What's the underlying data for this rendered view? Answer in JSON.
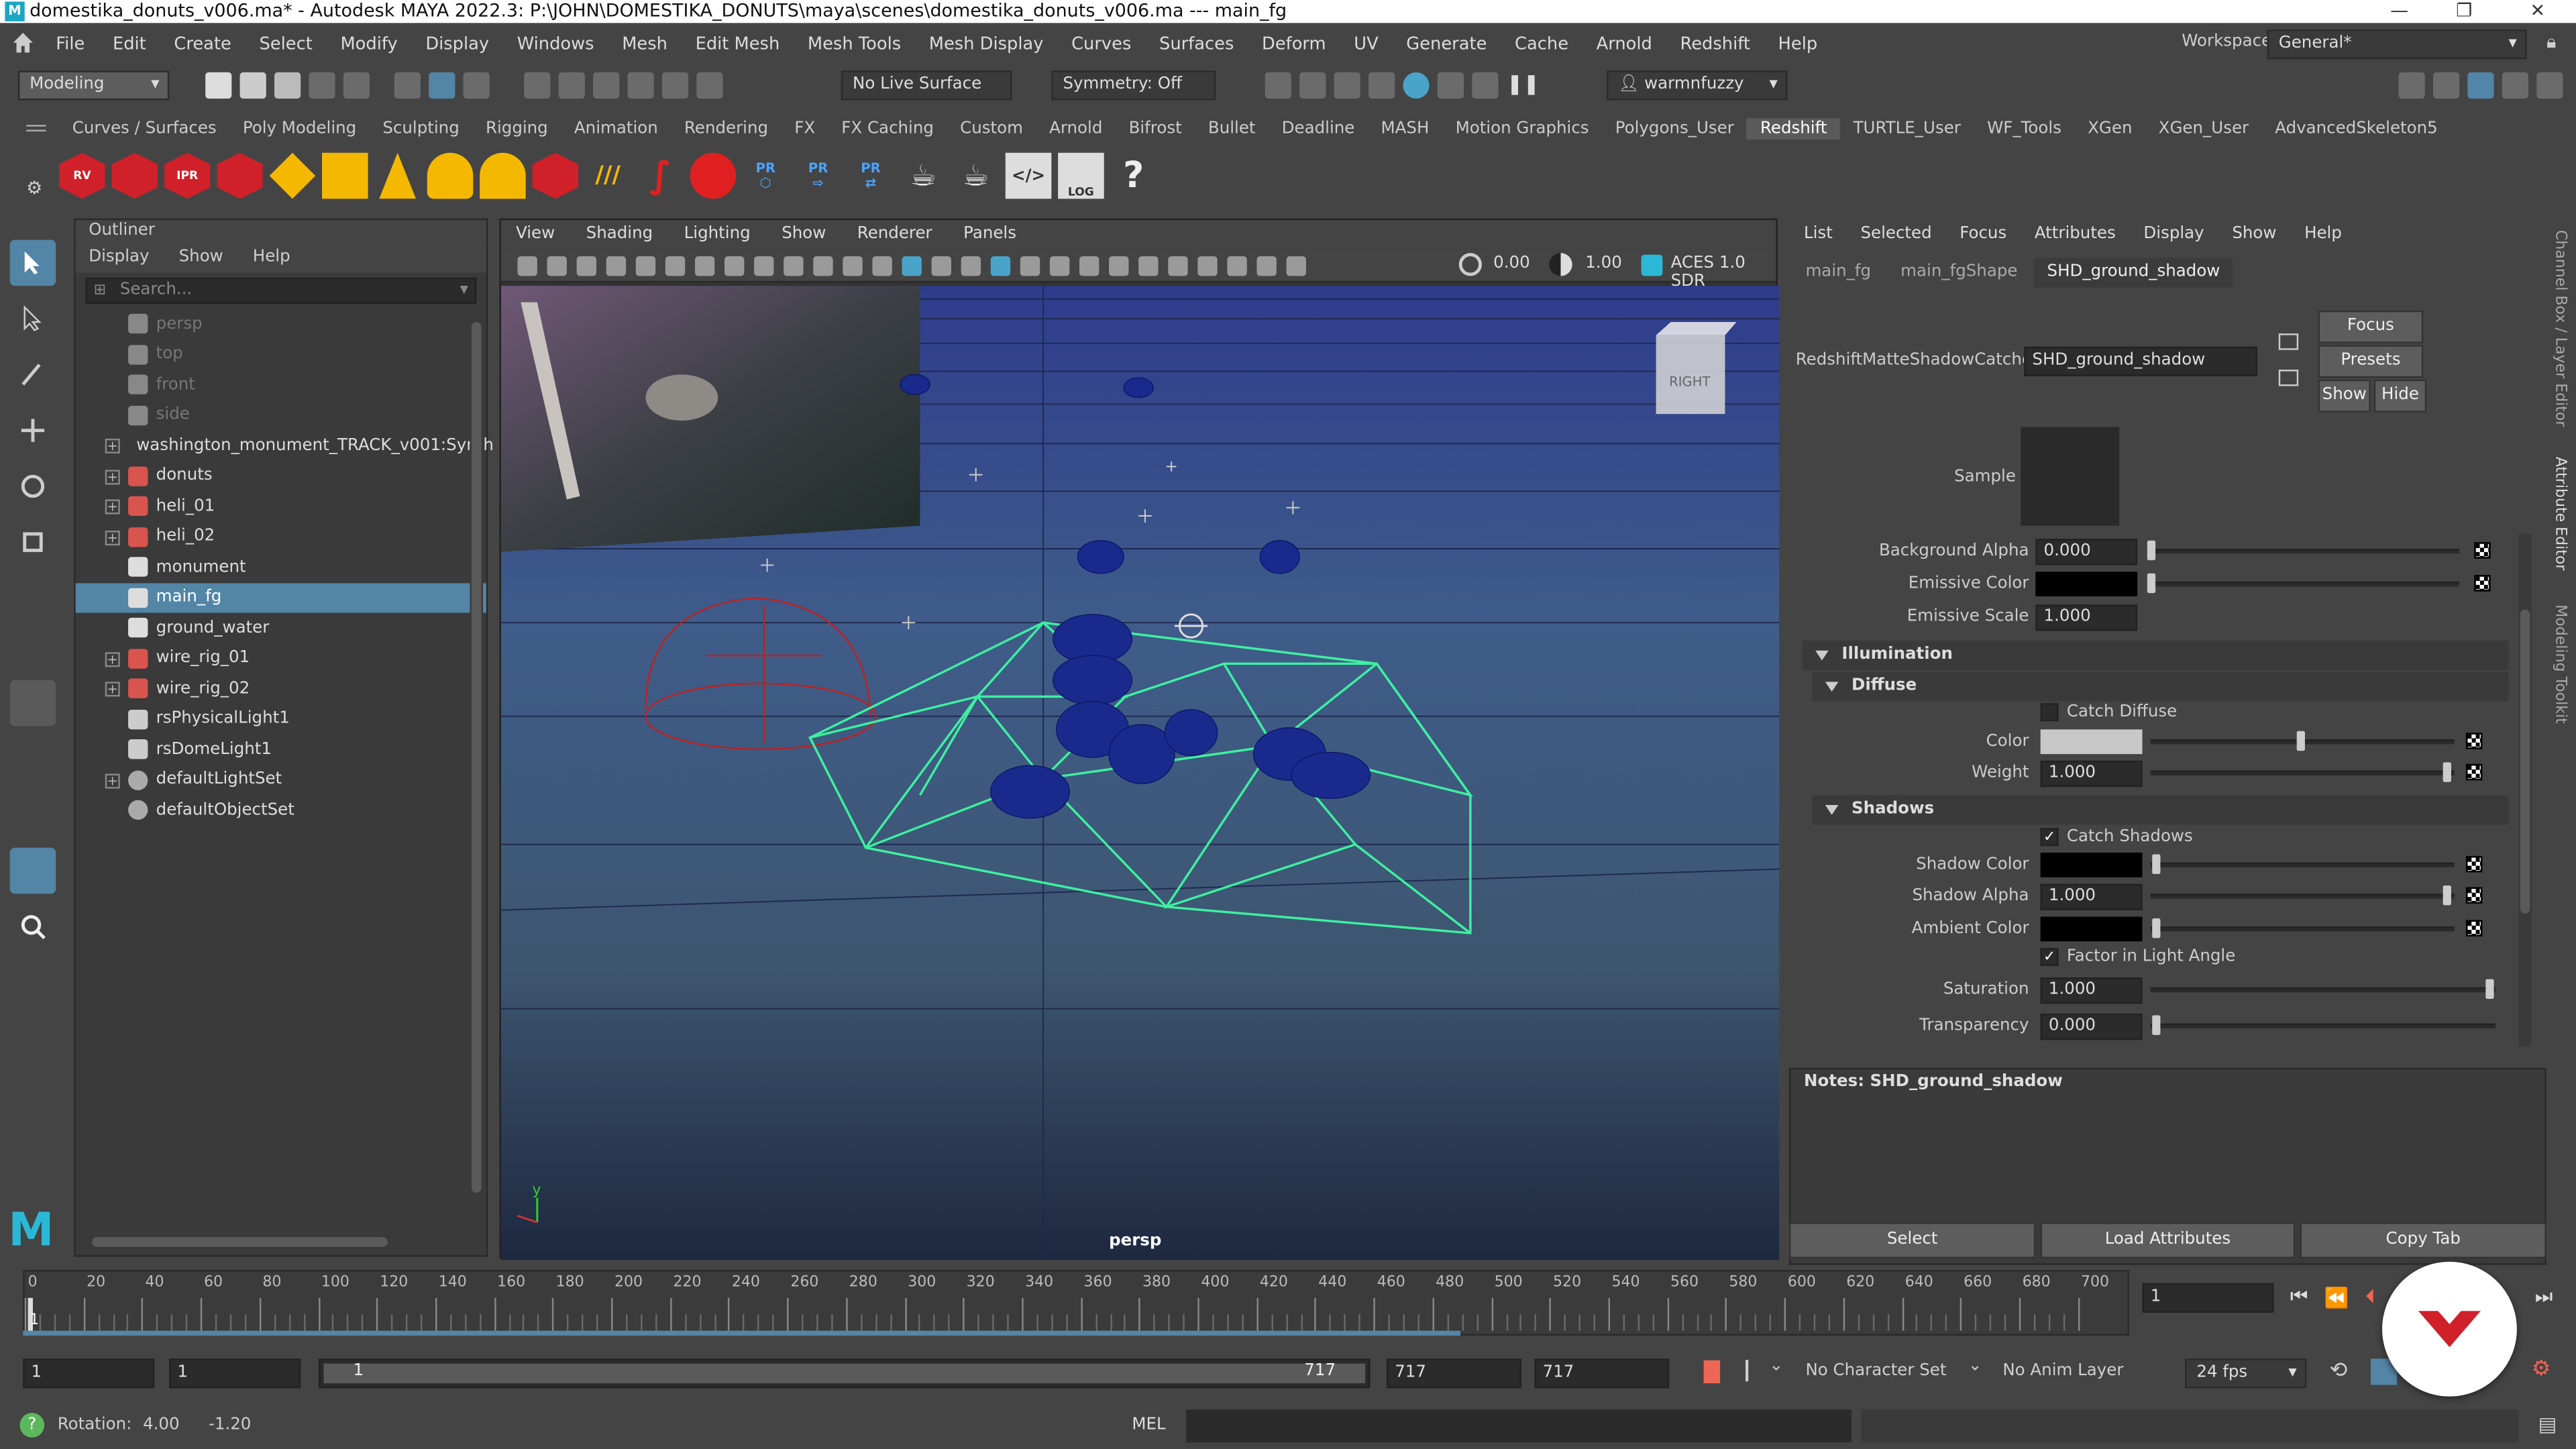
{
  "titlebar": {
    "text": "domestika_donuts_v006.ma* - Autodesk MAYA 2022.3: P:\\JOHN\\DOMESTIKA_DONUTS\\maya\\scenes\\domestika_donuts_v006.ma   ---   main_fg"
  },
  "menubar": {
    "items": [
      "File",
      "Edit",
      "Create",
      "Select",
      "Modify",
      "Display",
      "Windows",
      "Mesh",
      "Edit Mesh",
      "Mesh Tools",
      "Mesh Display",
      "Curves",
      "Surfaces",
      "Deform",
      "UV",
      "Generate",
      "Cache",
      "Arnold",
      "Redshift",
      "Help"
    ],
    "workspace_label": "Workspace:",
    "workspace_value": "General*"
  },
  "statusline": {
    "menuset": "Modeling",
    "live_surface": "No Live Surface",
    "symmetry": "Symmetry: Off",
    "user": "warmnfuzzy"
  },
  "shelf_tabs": {
    "items": [
      "Curves / Surfaces",
      "Poly Modeling",
      "Sculpting",
      "Rigging",
      "Animation",
      "Rendering",
      "FX",
      "FX Caching",
      "Custom",
      "Arnold",
      "Bifrost",
      "Bullet",
      "Deadline",
      "MASH",
      "Motion Graphics",
      "Polygons_User",
      "Redshift",
      "TURTLE_User",
      "WF_Tools",
      "XGen",
      "XGen_User",
      "AdvancedSkeleton5"
    ],
    "selected": "Redshift"
  },
  "shelf_icons": {
    "rv": "RV",
    "ipr": "IPR",
    "pr": "PR",
    "help": "?",
    "log": "LOG"
  },
  "outliner": {
    "title": "Outliner",
    "menu": [
      "Display",
      "Show",
      "Help"
    ],
    "search_placeholder": "Search...",
    "items": [
      "persp",
      "top",
      "front",
      "side",
      "washington_monument_TRACK_v001:Synth",
      "donuts",
      "heli_01",
      "heli_02",
      "monument",
      "main_fg",
      "ground_water",
      "wire_rig_01",
      "wire_rig_02",
      "rsPhysicalLight1",
      "rsDomeLight1",
      "defaultLightSet",
      "defaultObjectSet"
    ],
    "selected": "main_fg"
  },
  "viewport": {
    "menu": [
      "View",
      "Shading",
      "Lighting",
      "Show",
      "Renderer",
      "Panels"
    ],
    "exposure": "0.00",
    "gamma": "1.00",
    "colorspace": "ACES 1.0 SDR",
    "camera_label": "persp",
    "viewcube_label": "RIGHT",
    "axis_y": "y"
  },
  "attribute_editor": {
    "menu": [
      "List",
      "Selected",
      "Focus",
      "Attributes",
      "Display",
      "Show",
      "Help"
    ],
    "tabs": [
      "main_fg",
      "main_fgShape",
      "SHD_ground_shadow"
    ],
    "selected_tab": "SHD_ground_shadow",
    "node_type_label": "RedshiftMatteShadowCatcher:",
    "node_name": "SHD_ground_shadow",
    "buttons": {
      "focus": "Focus",
      "presets": "Presets",
      "show": "Show",
      "hide": "Hide"
    },
    "sample_label": "Sample",
    "background_alpha": {
      "label": "Background Alpha",
      "value": "0.000"
    },
    "emissive_color": {
      "label": "Emissive Color"
    },
    "emissive_scale": {
      "label": "Emissive Scale",
      "value": "1.000"
    },
    "illumination": "Illumination",
    "diffuse": "Diffuse",
    "catch_diffuse": "Catch Diffuse",
    "color_label": "Color",
    "weight": {
      "label": "Weight",
      "value": "1.000"
    },
    "shadows": "Shadows",
    "catch_shadows": "Catch Shadows",
    "shadow_color": "Shadow Color",
    "shadow_alpha": {
      "label": "Shadow Alpha",
      "value": "1.000"
    },
    "ambient_color": "Ambient Color",
    "factor_light_angle": "Factor in Light Angle",
    "saturation": {
      "label": "Saturation",
      "value": "1.000"
    },
    "transparency": {
      "label": "Transparency",
      "value": "0.000"
    },
    "notes": "Notes:  SHD_ground_shadow",
    "bottom_buttons": {
      "select": "Select",
      "load": "Load Attributes",
      "copy": "Copy Tab"
    }
  },
  "side_tabs": [
    "Channel Box / Layer Editor",
    "Attribute Editor",
    "Modeling Toolkit"
  ],
  "timeline": {
    "ticks": [
      "0",
      "20",
      "40",
      "60",
      "80",
      "100",
      "120",
      "140",
      "160",
      "180",
      "200",
      "220",
      "240",
      "260",
      "280",
      "300",
      "320",
      "340",
      "360",
      "380",
      "400",
      "420",
      "440",
      "460",
      "480",
      "500",
      "520",
      "540",
      "560",
      "580",
      "600",
      "620",
      "640",
      "660",
      "680",
      "700"
    ],
    "current_frame_marker": "1",
    "current_frame": "1"
  },
  "range": {
    "start": "1",
    "playback_start": "1",
    "range_start": "1",
    "range_end": "717",
    "playback_end": "717",
    "end": "717",
    "character_set": "No Character Set",
    "anim_layer": "No Anim Layer",
    "fps": "24 fps"
  },
  "command_line": {
    "help_label": "Rotation:",
    "val1": "4.00",
    "val2": "-1.20",
    "lang": "MEL"
  },
  "colors": {
    "accent": "#5285a6",
    "wire": "#3ef0a0",
    "donut": "#1a2a8c",
    "redshift": "#d0202a",
    "plane": "#3d5a86"
  }
}
